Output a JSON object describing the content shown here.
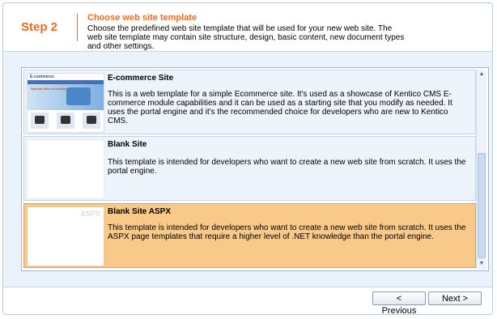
{
  "header": {
    "step": "Step 2",
    "title": "Choose web site template",
    "description": "Choose the predefined web site template that will be used for your new web site. The web site template may contain site structure, design, basic content, new document types and other settings."
  },
  "templates": [
    {
      "name": "E-commerce Site",
      "description": "This is a web template for a simple Ecommerce site. It's used as a showcase of Kentico CMS E-commerce module capabilities and it can be used as a starting site that you modify as needed. It uses the portal engine and it's the recommended choice for developers who are new to Kentico CMS.",
      "selected": false,
      "thumbnail": {
        "logo_text": "E-commerce",
        "banner_text": "Special offer of notebooks"
      }
    },
    {
      "name": "Blank Site",
      "description": "This template is intended for developers who want to create a new web site from scratch. It uses the portal engine.",
      "selected": false,
      "thumbnail": {}
    },
    {
      "name": "Blank Site ASPX",
      "description": "This template is intended for developers who want to create a new web site from scratch. It uses the ASPX page templates that require a higher level of .NET knowledge than the portal engine.",
      "selected": true,
      "thumbnail": {
        "label": "ASPX"
      }
    }
  ],
  "scrollbar": {
    "up_icon": "▲",
    "down_icon": "▼"
  },
  "buttons": {
    "previous": "< Previous",
    "next": "Next >"
  },
  "colors": {
    "accent": "#ec6a1e",
    "selected_row": "#f9c98a",
    "row_bg": "#edf4fc"
  }
}
